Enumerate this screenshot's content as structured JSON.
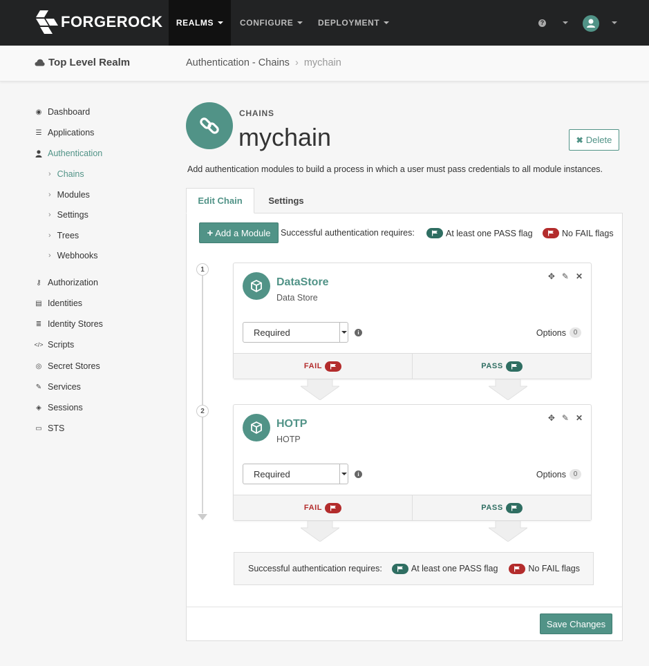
{
  "brand": {
    "logo_text": "FORGEROCK",
    "accent_color": "#519387",
    "pass_color": "#2f6e62",
    "fail_color": "#b32c2c"
  },
  "nav": {
    "items": [
      {
        "label": "REALMS",
        "active": true
      },
      {
        "label": "CONFIGURE",
        "active": false
      },
      {
        "label": "DEPLOYMENT",
        "active": false
      }
    ],
    "help_icon": "question-circle-icon",
    "user_icon": "user-avatar-icon"
  },
  "realm": {
    "name": "Top Level Realm"
  },
  "breadcrumb": {
    "section": "Authentication - Chains",
    "separator": "›",
    "current": "mychain"
  },
  "sidebar": {
    "items": [
      {
        "label": "Dashboard",
        "icon": "dashboard-icon"
      },
      {
        "label": "Applications",
        "icon": "applications-icon"
      },
      {
        "label": "Authentication",
        "icon": "user-icon",
        "active": true
      },
      {
        "label": "Authorization",
        "icon": "key-icon"
      },
      {
        "label": "Identities",
        "icon": "id-card-icon"
      },
      {
        "label": "Identity Stores",
        "icon": "database-icon"
      },
      {
        "label": "Scripts",
        "icon": "code-icon"
      },
      {
        "label": "Secret Stores",
        "icon": "eye-slash-icon"
      },
      {
        "label": "Services",
        "icon": "plug-icon"
      },
      {
        "label": "Sessions",
        "icon": "ticket-icon"
      },
      {
        "label": "STS",
        "icon": "credit-card-icon"
      }
    ],
    "subitems": [
      {
        "label": "Chains",
        "active": true
      },
      {
        "label": "Modules"
      },
      {
        "label": "Settings"
      },
      {
        "label": "Trees"
      },
      {
        "label": "Webhooks"
      }
    ]
  },
  "header": {
    "eyebrow": "CHAINS",
    "title": "mychain",
    "delete_label": "Delete",
    "description": "Add authentication modules to build a process in which a user must pass credentials to all module instances."
  },
  "tabs": [
    {
      "label": "Edit Chain",
      "active": true
    },
    {
      "label": "Settings",
      "active": false
    }
  ],
  "toolbar": {
    "add_module_label": "Add a Module",
    "requirement_label": "Successful authentication requires:",
    "pass_requirement": "At least one PASS flag",
    "fail_requirement": "No FAIL flags"
  },
  "modules": [
    {
      "step": "1",
      "name": "DataStore",
      "type": "Data Store",
      "criteria": "Required",
      "options_label": "Options",
      "options_count": "0",
      "fail_label": "FAIL",
      "pass_label": "PASS"
    },
    {
      "step": "2",
      "name": "HOTP",
      "type": "HOTP",
      "criteria": "Required",
      "options_label": "Options",
      "options_count": "0",
      "fail_label": "FAIL",
      "pass_label": "PASS"
    }
  ],
  "summary": {
    "label": "Successful authentication requires:",
    "pass_requirement": "At least one PASS flag",
    "fail_requirement": "No FAIL flags"
  },
  "footer": {
    "save_label": "Save Changes"
  }
}
